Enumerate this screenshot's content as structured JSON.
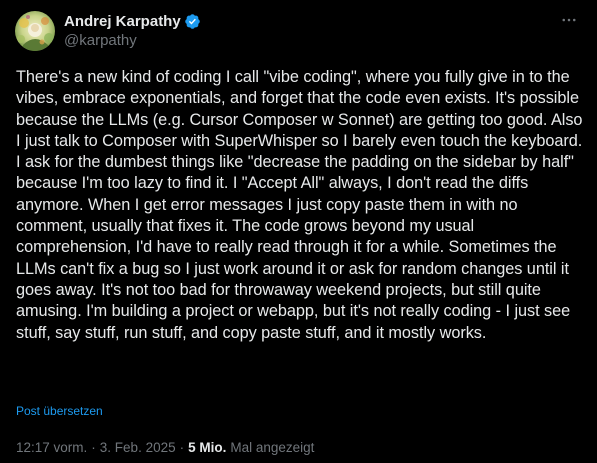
{
  "author": {
    "display_name": "Andrej Karpathy",
    "handle": "@karpathy",
    "verified_icon": "verified-badge-icon",
    "avatar_icon": "avatar-image"
  },
  "menu": {
    "more_icon": "more-options-icon"
  },
  "tweet": {
    "text": "There's a new kind of coding I call \"vibe coding\", where you fully give in to the vibes, embrace exponentials, and forget that the code even exists. It's possible because the LLMs (e.g. Cursor Composer w Sonnet) are getting too good. Also I just talk to Composer with SuperWhisper so I barely even touch the keyboard. I ask for the dumbest things like \"decrease the padding on the sidebar by half\" because I'm too lazy to find it. I \"Accept All\" always, I don't read the diffs anymore. When I get error messages I just copy paste them in with no comment, usually that fixes it. The code grows beyond my usual comprehension, I'd have to really read through it for a while. Sometimes the LLMs can't fix a bug so I just work around it or ask for random changes until it goes away. It's not too bad for throwaway weekend projects, but still quite amusing. I'm building a project or webapp, but it's not really coding - I just see stuff, say stuff, run stuff, and copy paste stuff, and it mostly works.",
    "translate_label": "Post übersetzen"
  },
  "meta": {
    "time": "12:17 vorm.",
    "separator": "·",
    "date": "3. Feb. 2025",
    "views_count": "5 Mio.",
    "views_label": "Mal angezeigt"
  },
  "colors": {
    "background": "#000000",
    "text": "#e7e9ea",
    "secondary": "#71767b",
    "link": "#1d9bf0",
    "verified": "#1d9bf0"
  }
}
